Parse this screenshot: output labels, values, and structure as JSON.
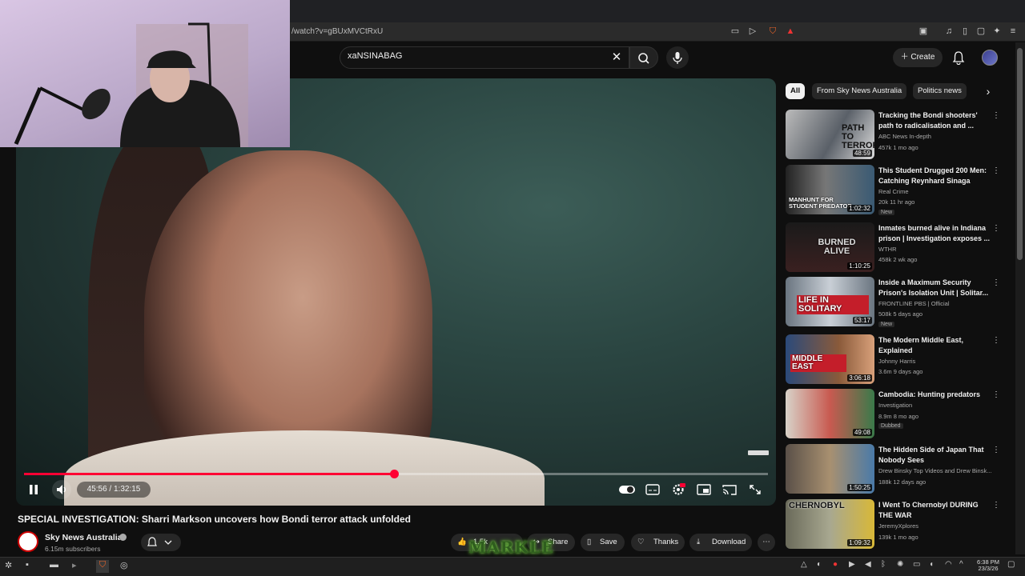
{
  "browser": {
    "url": "/watch?v=gBUxMVCtRxU"
  },
  "header": {
    "search_value": "xaNSINABAG",
    "create_label": "Create"
  },
  "player": {
    "time_display": "45:56 / 1:32:15",
    "progress_fraction": 0.497
  },
  "video": {
    "title": "SPECIAL INVESTIGATION: Sharri Markson uncovers how Bondi terror attack unfolded",
    "channel": "Sky News Australia",
    "subscribers": "6.15m subscribers",
    "like_count": "1.5k",
    "share_label": "Share",
    "save_label": "Save",
    "thanks_label": "Thanks",
    "download_label": "Download"
  },
  "chips": [
    "All",
    "From Sky News Australia",
    "Politics news"
  ],
  "recommendations": [
    {
      "title": "Tracking the Bondi shooters' path to radicalisation and ...",
      "channel": "ABC News In-depth",
      "meta": "457k  1 mo ago",
      "duration": "48:59",
      "thumb_text": "PATH TO TERROR",
      "badge": ""
    },
    {
      "title": "This Student Drugged 200 Men: Catching Reynhard Sinaga",
      "channel": "Real Crime",
      "meta": "20k  11 hr ago",
      "duration": "1:02:32",
      "thumb_text": "MANHUNT FOR STUDENT PREDATOR",
      "badge": "New"
    },
    {
      "title": "Inmates burned alive in Indiana prison | Investigation exposes ...",
      "channel": "WTHR",
      "meta": "458k  2 wk ago",
      "duration": "1:10:25",
      "thumb_text": "BURNED ALIVE",
      "badge": ""
    },
    {
      "title": "Inside a Maximum Security Prison's Isolation Unit | Solitar...",
      "channel": "FRONTLINE PBS | Official",
      "meta": "508k  5 days ago",
      "duration": "53:17",
      "thumb_text": "LIFE IN SOLITARY",
      "badge": "New"
    },
    {
      "title": "The Modern Middle East, Explained",
      "channel": "Johnny Harris",
      "meta": "3.6m  9 days ago",
      "duration": "3:06:18",
      "thumb_text": "MIDDLE EAST",
      "badge": ""
    },
    {
      "title": "Cambodia: Hunting predators",
      "channel": "Investigation",
      "meta": "8.9m  8 mo ago",
      "duration": "49:08",
      "thumb_text": "",
      "badge": "Dubbed"
    },
    {
      "title": "The Hidden Side of Japan That Nobody Sees",
      "channel": "Drew Binsky Top Videos and Drew Binsk...",
      "meta": "188k  12 days ago",
      "duration": "1:50:25",
      "thumb_text": "",
      "badge": ""
    },
    {
      "title": "I Went To Chernobyl DURING THE WAR",
      "channel": "JeremyXplores",
      "meta": "139k  1 mo ago",
      "duration": "1:09:32",
      "thumb_text": "CHERNOBYL",
      "badge": ""
    }
  ],
  "taskbar": {
    "time": "6:38 PM",
    "date": "23/3/26"
  },
  "overlay": {
    "logo_text": "MARKLE"
  },
  "colors": {
    "background": "#0f0f0f",
    "progress": "#ff0033",
    "chip_active": "#f1f1f1"
  }
}
